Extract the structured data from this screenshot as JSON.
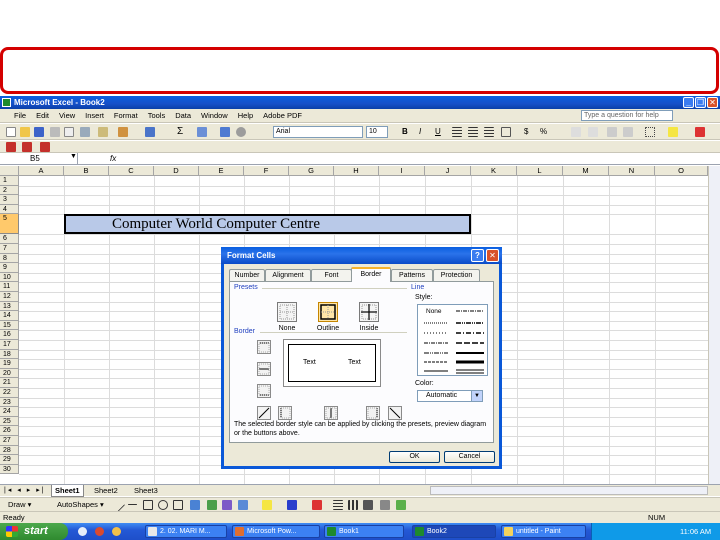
{
  "window": {
    "title": "Microsoft Excel - Book2"
  },
  "menu": {
    "items": [
      "File",
      "Edit",
      "View",
      "Insert",
      "Format",
      "Tools",
      "Data",
      "Window",
      "Help",
      "Adobe PDF"
    ],
    "help_placeholder": "Type a question for help"
  },
  "toolbar": {
    "font_name": "Arial",
    "font_size": "10",
    "bold": "B",
    "italic": "I",
    "underline": "U",
    "currency": "$",
    "percent": "%",
    "sum": "Σ"
  },
  "formula_bar": {
    "name_box": "B5",
    "fx": "fx"
  },
  "sheet": {
    "columns": [
      "A",
      "B",
      "C",
      "D",
      "E",
      "F",
      "G",
      "H",
      "I",
      "J",
      "K",
      "L",
      "M",
      "N",
      "O"
    ],
    "rows": [
      "1",
      "2",
      "3",
      "4",
      "5",
      "6",
      "7",
      "8",
      "9",
      "10",
      "11",
      "12",
      "13",
      "14",
      "15",
      "16",
      "17",
      "18",
      "19",
      "20",
      "21",
      "22",
      "23",
      "24",
      "25",
      "26",
      "27",
      "28",
      "29",
      "30"
    ],
    "selected_row": "5",
    "merged_cell_text": "Computer World Computer Centre",
    "tabs": [
      "Sheet1",
      "Sheet2",
      "Sheet3"
    ],
    "active_tab": "Sheet1"
  },
  "drawing_toolbar": {
    "draw_label": "Draw ▾",
    "autoshapes_label": "AutoShapes ▾"
  },
  "status": {
    "left": "Ready",
    "right": "NUM"
  },
  "taskbar": {
    "start": "start",
    "tasks": [
      "2. 02. MARI M...",
      "Microsoft Pow...",
      "Book1",
      "Book2",
      "untitled - Paint"
    ],
    "active_task": "Book2",
    "clock": "11:06 AM"
  },
  "dialog": {
    "title": "Format Cells",
    "tabs": [
      "Number",
      "Alignment",
      "Font",
      "Border",
      "Patterns",
      "Protection"
    ],
    "active_tab": "Border",
    "presets_label": "Presets",
    "presets": [
      "None",
      "Outline",
      "Inside"
    ],
    "border_label": "Border",
    "preview_text": [
      "Text",
      "Text"
    ],
    "line_label": "Line",
    "style_label": "Style:",
    "style_none": "None",
    "color_label": "Color:",
    "color_value": "Automatic",
    "hint": "The selected border style can be applied by clicking the presets, preview diagram or the buttons above.",
    "ok": "OK",
    "cancel": "Cancel",
    "help_btn": "?",
    "close_btn": "✕"
  }
}
